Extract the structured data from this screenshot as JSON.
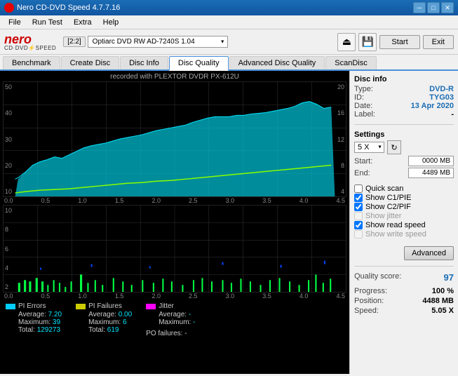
{
  "titlebar": {
    "title": "Nero CD-DVD Speed 4.7.7.16",
    "controls": {
      "minimize": "─",
      "maximize": "□",
      "close": "✕"
    }
  },
  "menubar": {
    "items": [
      "File",
      "Run Test",
      "Extra",
      "Help"
    ]
  },
  "toolbar": {
    "drive_badge": "[2:2]",
    "drive_name": "Optiarc DVD RW AD-7240S 1.04",
    "start_label": "Start",
    "exit_label": "Exit"
  },
  "tabs": [
    {
      "label": "Benchmark",
      "active": false
    },
    {
      "label": "Create Disc",
      "active": false
    },
    {
      "label": "Disc Info",
      "active": false
    },
    {
      "label": "Disc Quality",
      "active": true
    },
    {
      "label": "Advanced Disc Quality",
      "active": false
    },
    {
      "label": "ScanDisc",
      "active": false
    }
  ],
  "chart": {
    "title": "recorded with PLEXTOR  DVDR  PX-612U",
    "top_y_left": [
      "50",
      "40",
      "30",
      "20",
      "10"
    ],
    "top_y_right": [
      "20",
      "16",
      "12",
      "8",
      "4"
    ],
    "bottom_y_left": [
      "10",
      "8",
      "6",
      "4",
      "2"
    ],
    "x_labels": [
      "0.0",
      "0.5",
      "1.0",
      "1.5",
      "2.0",
      "2.5",
      "3.0",
      "3.5",
      "4.0",
      "4.5"
    ]
  },
  "legend": {
    "pi_errors": {
      "label": "PI Errors",
      "color": "#00ccff",
      "average_label": "Average:",
      "average_value": "7.20",
      "maximum_label": "Maximum:",
      "maximum_value": "39",
      "total_label": "Total:",
      "total_value": "129273"
    },
    "pi_failures": {
      "label": "PI Failures",
      "color": "#cccc00",
      "average_label": "Average:",
      "average_value": "0.00",
      "maximum_label": "Maximum:",
      "maximum_value": "6",
      "total_label": "Total:",
      "total_value": "619"
    },
    "jitter": {
      "label": "Jitter",
      "color": "#ff00ff",
      "average_label": "Average:",
      "average_value": "-",
      "maximum_label": "Maximum:",
      "maximum_value": "-"
    },
    "po_failures_label": "PO failures:",
    "po_failures_value": "-"
  },
  "right_panel": {
    "disc_info_title": "Disc info",
    "type_label": "Type:",
    "type_value": "DVD-R",
    "id_label": "ID:",
    "id_value": "TYG03",
    "date_label": "Date:",
    "date_value": "13 Apr 2020",
    "label_label": "Label:",
    "label_value": "-",
    "settings_title": "Settings",
    "speed_value": "5 X",
    "start_label": "Start:",
    "start_value": "0000 MB",
    "end_label": "End:",
    "end_value": "4489 MB",
    "quick_scan_label": "Quick scan",
    "quick_scan_checked": false,
    "show_c1pie_label": "Show C1/PIE",
    "show_c1pie_checked": true,
    "show_c2pif_label": "Show C2/PIF",
    "show_c2pif_checked": true,
    "show_jitter_label": "Show jitter",
    "show_jitter_checked": false,
    "show_jitter_disabled": true,
    "show_read_speed_label": "Show read speed",
    "show_read_speed_checked": true,
    "show_write_speed_label": "Show write speed",
    "show_write_speed_checked": false,
    "show_write_speed_disabled": true,
    "advanced_btn_label": "Advanced",
    "quality_score_label": "Quality score:",
    "quality_score_value": "97",
    "progress_label": "Progress:",
    "progress_value": "100 %",
    "position_label": "Position:",
    "position_value": "4488 MB",
    "speed_label": "Speed:",
    "speed_display": "5.05 X"
  }
}
